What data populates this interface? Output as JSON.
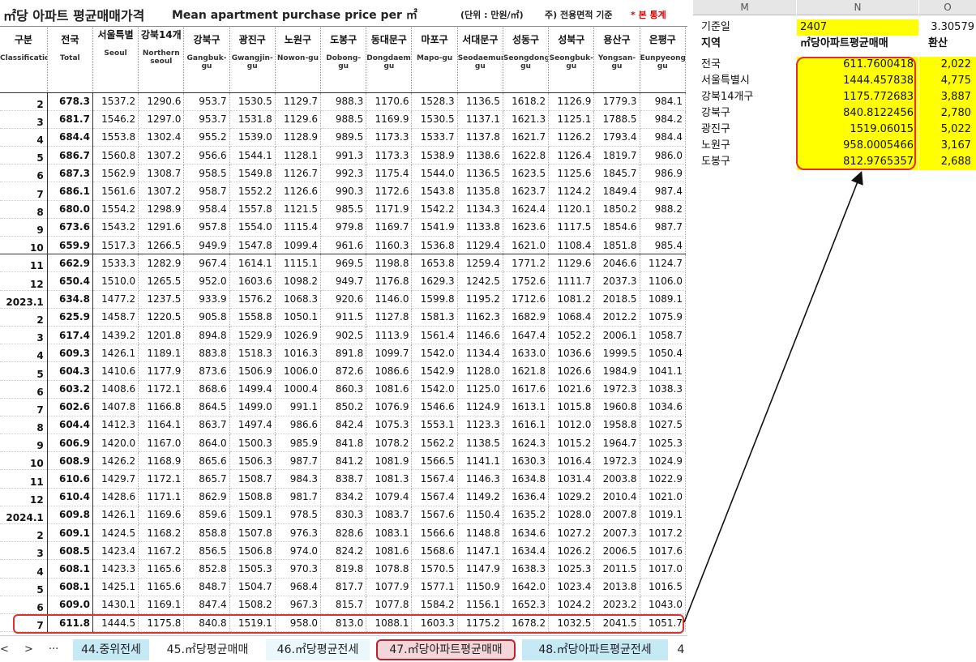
{
  "title": {
    "ko": "㎡당 아파트 평균매매가격",
    "en": "Mean apartment purchase price per ㎡",
    "unit": "(단위 : 만원/㎡)",
    "note": "주) 전용면적 기준",
    "star": "* 본 통계"
  },
  "columns": [
    {
      "ko": "구분",
      "en": "Classification"
    },
    {
      "ko": "전국",
      "en": "Total"
    },
    {
      "ko": "서울특별",
      "en": "Seoul"
    },
    {
      "ko": "강북14개",
      "en": "Northern seoul"
    },
    {
      "ko": "강북구",
      "en": "Gangbuk-gu"
    },
    {
      "ko": "광진구",
      "en": "Gwangjin-gu"
    },
    {
      "ko": "노원구",
      "en": "Nowon-gu"
    },
    {
      "ko": "도봉구",
      "en": "Dobong-gu"
    },
    {
      "ko": "동대문구",
      "en": "Dongdaemun-gu"
    },
    {
      "ko": "마포구",
      "en": "Mapo-gu"
    },
    {
      "ko": "서대문구",
      "en": "Seodaemun-gu"
    },
    {
      "ko": "성동구",
      "en": "Seongdong-gu"
    },
    {
      "ko": "성북구",
      "en": "Seongbuk-gu"
    },
    {
      "ko": "용산구",
      "en": "Yongsan-gu"
    },
    {
      "ko": "은평구",
      "en": "Eunpyeong-gu"
    }
  ],
  "rows": [
    {
      "label": "2",
      "v": [
        "678.3",
        "1537.2",
        "1290.6",
        "953.7",
        "1530.5",
        "1129.7",
        "988.3",
        "1170.6",
        "1528.3",
        "1136.5",
        "1618.2",
        "1126.9",
        "1779.3",
        "984.1"
      ]
    },
    {
      "label": "3",
      "v": [
        "681.7",
        "1546.2",
        "1297.0",
        "953.7",
        "1531.8",
        "1129.6",
        "988.5",
        "1169.9",
        "1530.5",
        "1137.1",
        "1621.3",
        "1125.1",
        "1788.5",
        "984.2"
      ]
    },
    {
      "label": "4",
      "v": [
        "684.4",
        "1553.8",
        "1302.4",
        "955.2",
        "1539.0",
        "1128.9",
        "989.5",
        "1173.3",
        "1533.7",
        "1137.8",
        "1621.7",
        "1126.2",
        "1793.4",
        "984.4"
      ]
    },
    {
      "label": "5",
      "v": [
        "686.7",
        "1560.8",
        "1307.2",
        "956.6",
        "1544.1",
        "1128.1",
        "991.3",
        "1173.3",
        "1538.9",
        "1138.6",
        "1622.8",
        "1126.4",
        "1819.7",
        "986.0"
      ]
    },
    {
      "label": "6",
      "v": [
        "687.3",
        "1562.9",
        "1308.7",
        "958.5",
        "1549.8",
        "1126.7",
        "992.3",
        "1175.4",
        "1544.0",
        "1136.5",
        "1623.5",
        "1125.6",
        "1845.7",
        "986.9"
      ]
    },
    {
      "label": "7",
      "v": [
        "686.1",
        "1561.6",
        "1307.2",
        "958.7",
        "1552.2",
        "1126.6",
        "990.3",
        "1172.6",
        "1543.8",
        "1135.8",
        "1623.7",
        "1124.2",
        "1849.4",
        "987.4"
      ]
    },
    {
      "label": "8",
      "v": [
        "680.0",
        "1554.2",
        "1298.9",
        "958.4",
        "1557.8",
        "1121.5",
        "985.5",
        "1171.9",
        "1542.2",
        "1134.3",
        "1624.4",
        "1120.1",
        "1850.2",
        "988.2"
      ]
    },
    {
      "label": "9",
      "v": [
        "673.6",
        "1543.2",
        "1291.6",
        "957.8",
        "1554.0",
        "1115.4",
        "979.8",
        "1169.7",
        "1541.9",
        "1133.8",
        "1623.6",
        "1117.5",
        "1854.6",
        "987.7"
      ]
    },
    {
      "label": "10",
      "v": [
        "659.9",
        "1517.3",
        "1266.5",
        "949.9",
        "1547.8",
        "1099.4",
        "961.6",
        "1160.3",
        "1536.8",
        "1129.4",
        "1621.0",
        "1108.4",
        "1851.8",
        "985.4"
      ]
    },
    {
      "label": "11",
      "v": [
        "662.9",
        "1533.3",
        "1282.9",
        "967.4",
        "1614.1",
        "1115.1",
        "969.5",
        "1198.8",
        "1653.8",
        "1259.4",
        "1771.2",
        "1129.6",
        "2046.6",
        "1124.7"
      ]
    },
    {
      "label": "12",
      "v": [
        "650.4",
        "1510.0",
        "1265.5",
        "952.0",
        "1603.6",
        "1098.2",
        "949.7",
        "1176.8",
        "1629.3",
        "1242.5",
        "1752.6",
        "1111.7",
        "2037.3",
        "1106.0"
      ]
    },
    {
      "label": "2023.1",
      "v": [
        "634.8",
        "1477.2",
        "1237.5",
        "933.9",
        "1576.2",
        "1068.3",
        "920.6",
        "1146.0",
        "1599.8",
        "1195.2",
        "1712.6",
        "1081.2",
        "2018.5",
        "1089.1"
      ]
    },
    {
      "label": "2",
      "v": [
        "625.9",
        "1458.7",
        "1220.5",
        "905.8",
        "1558.8",
        "1050.1",
        "911.5",
        "1127.8",
        "1581.3",
        "1162.3",
        "1682.9",
        "1068.4",
        "2012.2",
        "1075.9"
      ]
    },
    {
      "label": "3",
      "v": [
        "617.4",
        "1439.2",
        "1201.8",
        "894.8",
        "1529.9",
        "1026.9",
        "902.5",
        "1113.9",
        "1561.4",
        "1146.6",
        "1647.4",
        "1052.2",
        "2006.1",
        "1058.7"
      ]
    },
    {
      "label": "4",
      "v": [
        "609.3",
        "1426.1",
        "1189.1",
        "883.8",
        "1518.3",
        "1016.3",
        "891.8",
        "1099.7",
        "1542.0",
        "1134.4",
        "1633.0",
        "1036.6",
        "1999.5",
        "1050.4"
      ]
    },
    {
      "label": "5",
      "v": [
        "604.3",
        "1410.6",
        "1177.9",
        "873.6",
        "1506.9",
        "1006.0",
        "872.6",
        "1086.6",
        "1542.9",
        "1128.0",
        "1621.8",
        "1026.6",
        "1984.9",
        "1041.1"
      ]
    },
    {
      "label": "6",
      "v": [
        "603.2",
        "1408.6",
        "1172.1",
        "868.6",
        "1499.4",
        "1000.4",
        "860.3",
        "1081.6",
        "1542.0",
        "1125.0",
        "1617.6",
        "1021.6",
        "1972.3",
        "1038.3"
      ]
    },
    {
      "label": "7",
      "v": [
        "602.6",
        "1407.8",
        "1166.8",
        "864.5",
        "1499.0",
        "991.1",
        "850.2",
        "1076.9",
        "1546.6",
        "1124.9",
        "1613.1",
        "1015.8",
        "1960.8",
        "1034.6"
      ]
    },
    {
      "label": "8",
      "v": [
        "604.4",
        "1412.3",
        "1164.1",
        "863.7",
        "1497.4",
        "986.6",
        "842.4",
        "1075.3",
        "1553.1",
        "1123.3",
        "1616.1",
        "1012.0",
        "1958.8",
        "1027.5"
      ]
    },
    {
      "label": "9",
      "v": [
        "606.9",
        "1420.0",
        "1167.0",
        "864.0",
        "1500.3",
        "985.9",
        "841.8",
        "1078.2",
        "1562.2",
        "1138.5",
        "1624.3",
        "1015.2",
        "1964.7",
        "1025.3"
      ]
    },
    {
      "label": "10",
      "v": [
        "608.9",
        "1426.2",
        "1168.9",
        "865.6",
        "1506.3",
        "987.7",
        "841.2",
        "1081.9",
        "1566.5",
        "1141.1",
        "1630.3",
        "1016.4",
        "1972.3",
        "1024.9"
      ]
    },
    {
      "label": "11",
      "v": [
        "610.6",
        "1429.7",
        "1172.1",
        "865.7",
        "1508.7",
        "984.3",
        "838.7",
        "1081.3",
        "1567.4",
        "1146.3",
        "1634.8",
        "1031.4",
        "2003.8",
        "1022.9"
      ]
    },
    {
      "label": "12",
      "v": [
        "610.4",
        "1428.6",
        "1171.1",
        "862.9",
        "1508.8",
        "981.7",
        "834.2",
        "1079.4",
        "1567.4",
        "1149.2",
        "1636.4",
        "1029.2",
        "2010.4",
        "1021.0"
      ]
    },
    {
      "label": "2024.1",
      "v": [
        "609.8",
        "1426.1",
        "1169.6",
        "859.6",
        "1509.1",
        "978.5",
        "830.3",
        "1083.7",
        "1567.6",
        "1150.4",
        "1635.2",
        "1028.0",
        "2007.8",
        "1019.1"
      ]
    },
    {
      "label": "2",
      "v": [
        "609.1",
        "1424.5",
        "1168.2",
        "858.8",
        "1507.8",
        "976.3",
        "828.6",
        "1083.1",
        "1566.6",
        "1148.8",
        "1634.6",
        "1027.2",
        "2007.3",
        "1017.2"
      ]
    },
    {
      "label": "3",
      "v": [
        "608.5",
        "1423.4",
        "1167.2",
        "856.5",
        "1506.8",
        "974.0",
        "824.2",
        "1081.6",
        "1568.6",
        "1147.1",
        "1634.4",
        "1026.2",
        "2006.5",
        "1017.6"
      ]
    },
    {
      "label": "4",
      "v": [
        "608.1",
        "1423.3",
        "1165.6",
        "852.8",
        "1505.3",
        "970.3",
        "819.8",
        "1078.8",
        "1570.5",
        "1147.9",
        "1638.3",
        "1025.3",
        "2011.5",
        "1017.0"
      ]
    },
    {
      "label": "5",
      "v": [
        "608.1",
        "1425.1",
        "1165.6",
        "848.7",
        "1504.7",
        "968.4",
        "817.7",
        "1077.9",
        "1577.1",
        "1150.9",
        "1642.0",
        "1023.4",
        "2013.8",
        "1016.5"
      ]
    },
    {
      "label": "6",
      "v": [
        "609.0",
        "1430.1",
        "1169.1",
        "847.4",
        "1508.2",
        "967.3",
        "815.7",
        "1077.8",
        "1584.2",
        "1156.1",
        "1652.3",
        "1024.2",
        "2023.2",
        "1043.0"
      ]
    },
    {
      "label": "7",
      "v": [
        "611.8",
        "1444.5",
        "1175.8",
        "840.8",
        "1519.1",
        "958.0",
        "813.0",
        "1088.1",
        "1603.3",
        "1175.2",
        "1678.2",
        "1032.5",
        "2041.5",
        "1051.7"
      ]
    }
  ],
  "tabs": {
    "nav_more": "···",
    "nav_next": ">",
    "nav_prev": "<",
    "t44": "44.중위전세",
    "t45": "45.㎡당평균매매",
    "t46": "46.㎡당평균전세",
    "t47": "47.㎡당아파트평균매매",
    "t48": "48.㎡당아파트평균전세",
    "t49": "4"
  },
  "sheet": {
    "cols": [
      "M",
      "N",
      "O"
    ],
    "base_label": "기준일",
    "base_value": "2407",
    "factor": "3.30579",
    "h_region": "지역",
    "h_value": "㎡당아파트평균매매",
    "h_conv": "환산",
    "regions": [
      {
        "name": "전국",
        "value": "611.7600418",
        "conv": "2,022"
      },
      {
        "name": "서울특별시",
        "value": "1444.457838",
        "conv": "4,775"
      },
      {
        "name": "강북14개구",
        "value": "1175.772683",
        "conv": "3,887"
      },
      {
        "name": "강북구",
        "value": "840.8122456",
        "conv": "2,780"
      },
      {
        "name": "광진구",
        "value": "1519.06015",
        "conv": "5,022"
      },
      {
        "name": "노원구",
        "value": "958.0005466",
        "conv": "3,167"
      },
      {
        "name": "도봉구",
        "value": "812.9765357",
        "conv": "2,688"
      }
    ]
  },
  "colors": {
    "highlight": "#e03030",
    "yellow": "#ffff00",
    "tab_blue": "#c6e9f6",
    "tab_active": "#f4d6da"
  }
}
